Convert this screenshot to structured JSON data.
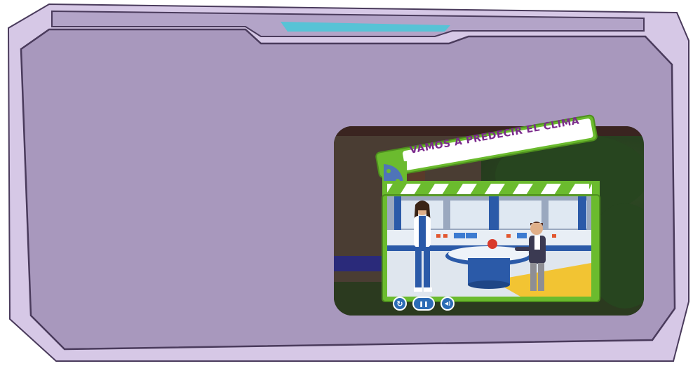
{
  "video": {
    "title": "VAMOS A PREDECIR EL CLIMA"
  },
  "controls": {
    "replay_icon": "↻",
    "pause_icon": "❚❚",
    "volume_icon": "◀)"
  },
  "colors": {
    "panel": "#a898bd",
    "panel_border": "#4a3b5c",
    "frame_light": "#d6c8e6",
    "accent_cyan": "#57c3d6",
    "clapper_green": "#6bbb2e",
    "title_purple": "#7b2a8c",
    "button_blue": "#2c6bb5"
  }
}
